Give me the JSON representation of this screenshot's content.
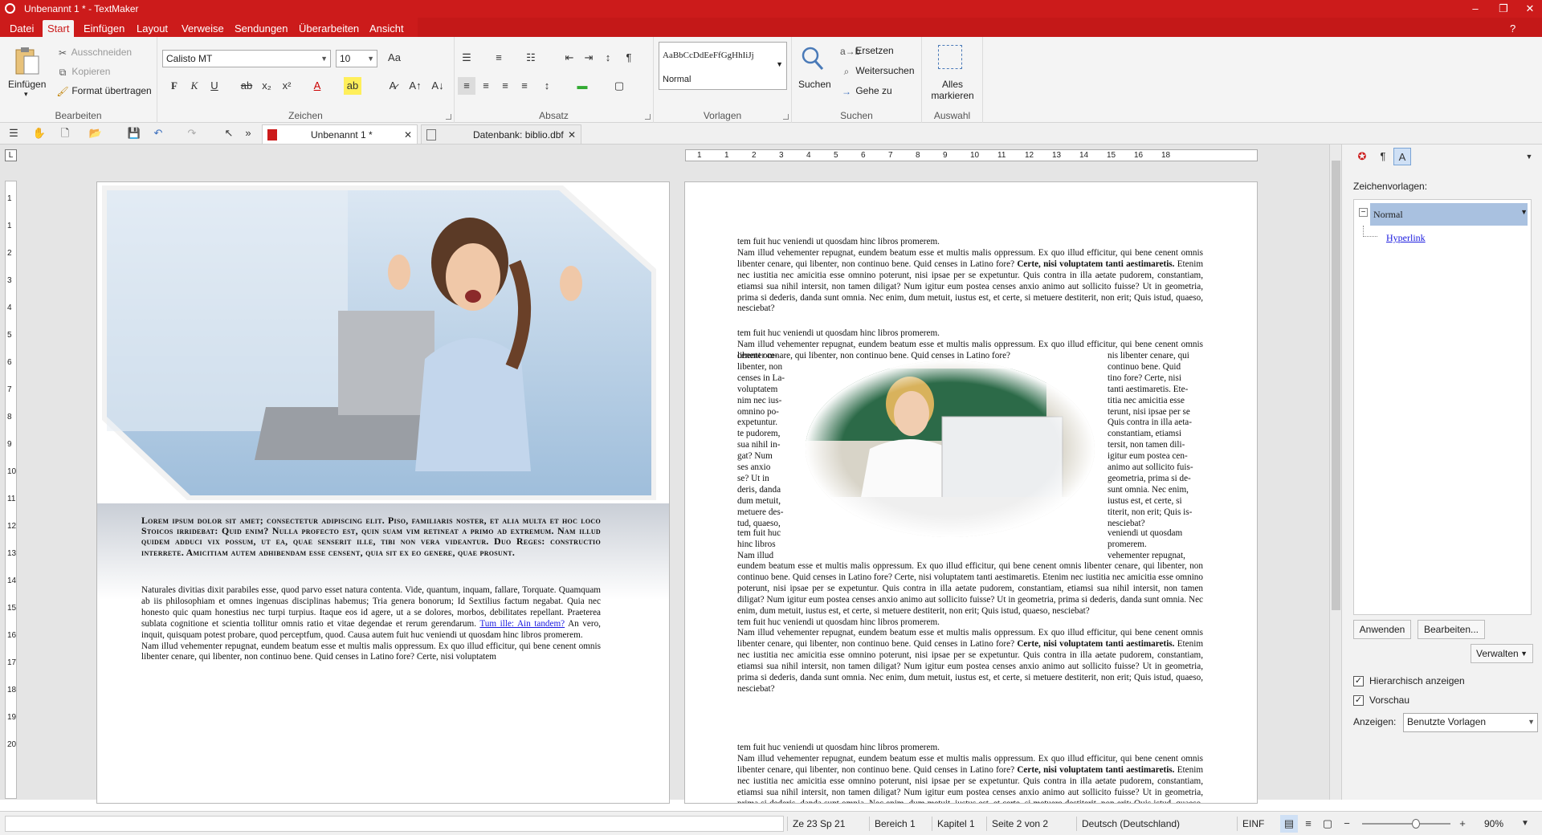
{
  "window": {
    "title": "Unbenannt 1 * - TextMaker",
    "min": "–",
    "restore": "❐",
    "close": "✕"
  },
  "menu": {
    "items": [
      "Datei",
      "Start",
      "Einfügen",
      "Layout",
      "Verweise",
      "Sendungen",
      "Überarbeiten",
      "Ansicht"
    ],
    "help": "?"
  },
  "ribbon": {
    "paste": "Einfügen",
    "cut": "Ausschneiden",
    "copy": "Kopieren",
    "format_painter": "Format übertragen",
    "group_edit": "Bearbeiten",
    "font_name": "Calisto MT",
    "font_size": "10",
    "group_chars": "Zeichen",
    "bold": "F",
    "italic": "K",
    "underline": "U",
    "group_para": "Absatz",
    "style_preview": "AaBbCcDdEeFfGgHhIiJj",
    "style_name": "Normal",
    "group_styles": "Vorlagen",
    "search": "Suchen",
    "replace": "Ersetzen",
    "find_next": "Weitersuchen",
    "goto": "Gehe zu",
    "group_search": "Suchen",
    "select_all": "Alles markieren",
    "group_select": "Auswahl"
  },
  "doctabs": [
    {
      "label": "Unbenannt 1 *"
    },
    {
      "label": "Datenbank: biblio.dbf"
    }
  ],
  "ruler": {
    "h": [
      "1",
      "1",
      "2",
      "3",
      "4",
      "5",
      "6",
      "7",
      "8",
      "9",
      "10",
      "11",
      "12",
      "13",
      "14",
      "15",
      "16",
      "18"
    ],
    "v": [
      "1",
      "1",
      "2",
      "3",
      "4",
      "5",
      "6",
      "7",
      "8",
      "9",
      "10",
      "11",
      "12",
      "13",
      "14",
      "15",
      "16",
      "17",
      "18",
      "19",
      "20"
    ]
  },
  "page1": {
    "heading": "Lorem ipsum dolor sit amet; consectetur adipiscing elit. Piso, familiaris noster, et alia multa et hoc loco Stoicos irridebat: Quid enim? Nulla profecto est, quin suam vim retineat a primo ad extremum. Nam illud quidem adduci vix possum, ut ea, quae senserit ille, tibi non vera videantur. Duo Reges: constructio interrete. Amicitiam autem adhibendam esse censent, quia sit ex eo genere, quae prosunt.",
    "body1": "Naturales divitias dixit parabiles esse, quod parvo esset natura contenta. Vide, quantum, inquam, fallare, Torquate. Quamquam ab iis philosophiam et omnes ingenuas disciplinas habemus; Tria genera bonorum; Id Sextilius factum negabat. Quia nec honesto quic quam honestius nec turpi turpius. Itaque eos id agere, ut a se dolores, morbos, debilitates repellant. Praeterea sublata cognitione et scientia tollitur omnis ratio et vitae degendae et rerum gerendarum.",
    "link": "Tum ille: Ain tandem?",
    "body2": "An vero, inquit, quisquam potest probare, quod perceptfum, quod. Causa autem fuit huc veniendi ut quosdam hinc libros promerem.",
    "body3": "Nam illud vehementer repugnat, eundem beatum esse et multis malis oppressum. Ex quo illud efficitur, qui bene cenent omnis libenter cenare, qui libenter, non continuo bene. Quid censes in Latino fore? Certe, nisi voluptatem"
  },
  "page2": {
    "intro": "tem fuit huc veniendi ut quosdam hinc libros promerem.",
    "para": "Nam illud vehementer repugnat, eundem beatum esse et multis malis oppressum. Ex quo illud efficitur, qui bene cenent omnis libenter cenare, qui libenter, non continuo bene. Quid censes in Latino fore?",
    "bold": "Certe, nisi voluptatem tanti aestimaretis.",
    "para2": "Etenim nec iustitia nec amicitia esse omnino poterunt, nisi ipsae per se expetuntur. Quis contra in illa aetate pudorem, constantiam, etiamsi sua nihil intersit, non tamen diligat? Num igitur eum postea censes anxio animo aut sollicito fuisse? Ut in geometria, prima si dederis, danda sunt omnia. Nec enim, dum metuit, iustus est, et certe, si metuere destiterit, non erit; Quis istud, quaeso, nesciebat?",
    "left_col": [
      "cenent om-",
      "libenter, non",
      "censes in La-",
      "voluptatem",
      "nim nec ius-",
      "omnino po-",
      "expetuntur.",
      "te pudorem,",
      "sua nihil in-",
      "gat? Num",
      "ses anxio",
      "se? Ut in",
      "deris, danda",
      "dum metuit,",
      "metuere des-",
      "tud, quaeso,"
    ],
    "right_col": [
      "nis libenter cenare, qui",
      "continuo bene. Quid",
      "tino fore? Certe, nisi",
      "tanti aestimaretis. Ete-",
      "titia nec amicitia esse",
      "terunt, nisi ipsae per se",
      "Quis contra in illa aeta-",
      "constantiam, etiamsi",
      "tersit, non tamen dili-",
      "igitur eum postea cen-",
      "animo aut sollicito fuis-",
      "geometria, prima si de-",
      "sunt omnia. Nec enim,",
      "iustus est, et certe, si",
      "titerit, non erit; Quis is-",
      "nesciebat?"
    ],
    "wrap_left2": [
      "tem fuit huc",
      "hinc libros",
      "Nam illud"
    ],
    "wrap_right2": [
      "veniendi ut quosdam",
      "promerem.",
      "vehementer repugnat,"
    ],
    "after": "eundem beatum esse et multis malis oppressum. Ex quo illud efficitur, qui bene cenent omnis libenter cenare, qui libenter, non continuo bene. Quid censes in Latino fore? Certe, nisi voluptatem tanti aestimaretis. Etenim nec iustitia nec amicitia esse omnino poterunt, nisi ipsae per se expetuntur. Quis contra in illa aetate pudorem, constantiam, etiamsi sua nihil intersit, non tamen diligat? Num igitur eum postea censes anxio animo aut sollicito fuisse? Ut in geometria, prima si dederis, danda sunt omnia. Nec enim, dum metuit, iustus est, et certe, si metuere destiterit, non erit; Quis istud, quaeso, nesciebat?"
  },
  "sidepanel": {
    "heading": "Zeichenvorlagen:",
    "selected": "Normal",
    "child": "Hyperlink",
    "apply": "Anwenden",
    "edit": "Bearbeiten...",
    "manage": "Verwalten",
    "hier": "Hierarchisch anzeigen",
    "preview": "Vorschau",
    "show_label": "Anzeigen:",
    "show_value": "Benutzte Vorlagen"
  },
  "status": {
    "pos": "Ze 23 Sp 21",
    "area": "Bereich 1",
    "chapter": "Kapitel 1",
    "page": "Seite 2 von 2",
    "lang": "Deutsch (Deutschland)",
    "mode": "EINF",
    "zoom": "90%"
  }
}
